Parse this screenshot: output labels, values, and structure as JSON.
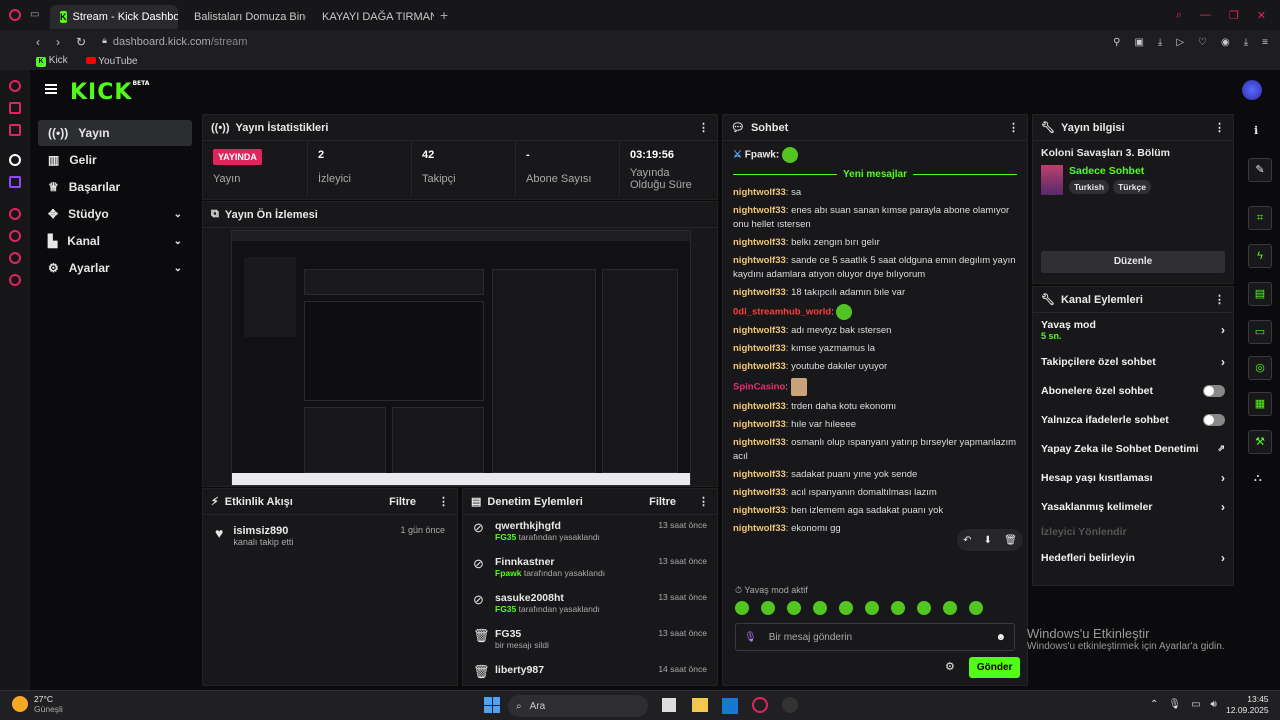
{
  "browser": {
    "tabs": [
      {
        "label": "Stream - Kick Dashboard"
      },
      {
        "label": "Balistaları Domuza Bindir"
      },
      {
        "label": "KAYAYI DAĞA TIRMANDIR"
      }
    ],
    "url_host": "dashboard.kick.com",
    "url_path": "/stream",
    "bookmarks": [
      "Kick",
      "YouTube"
    ]
  },
  "nav": {
    "items": [
      {
        "label": "Yayın"
      },
      {
        "label": "Gelir"
      },
      {
        "label": "Başarılar"
      },
      {
        "label": "Stüdyo"
      },
      {
        "label": "Kanal"
      },
      {
        "label": "Ayarlar"
      }
    ]
  },
  "stats": {
    "title": "Yayın İstatistikleri",
    "live_badge": "YAYINDA",
    "live_label": "Yayın",
    "viewers_value": "2",
    "viewers_label": "İzleyici",
    "followers_value": "42",
    "followers_label": "Takipçi",
    "subs_value": "-",
    "subs_label": "Abone Sayısı",
    "duration_value": "03:19:56",
    "duration_label": "Yayında Olduğu Süre"
  },
  "preview": {
    "title": "Yayın Ön İzlemesi"
  },
  "activity": {
    "title": "Etkinlik Akışı",
    "filter": "Filtre",
    "items": [
      {
        "user": "isimsiz890",
        "action": "kanalı takip etti",
        "time": "1 gün önce"
      }
    ]
  },
  "moderation": {
    "title": "Denetim Eylemleri",
    "filter": "Filtre",
    "items": [
      {
        "user": "qwerthkjhgfd",
        "by": "FG35",
        "action": "tarafından yasaklandı",
        "time": "13 saat önce"
      },
      {
        "user": "Finnkastner",
        "by": "Fpawk",
        "action": "tarafından yasaklandı",
        "time": "13 saat önce"
      },
      {
        "user": "sasuke2008ht",
        "by": "FG35",
        "action": "tarafından yasaklandı",
        "time": "13 saat önce"
      },
      {
        "user": "FG35",
        "by": "",
        "action": "bir mesajı sildi",
        "time": "13 saat önce"
      },
      {
        "user": "liberty987",
        "by": "",
        "action": "",
        "time": "14 saat önce"
      }
    ]
  },
  "chat": {
    "title": "Sohbet",
    "top_user": "Fpawk",
    "new_messages": "Yeni mesajlar",
    "messages": [
      {
        "user": "nightwolf33",
        "text": "sa"
      },
      {
        "user": "nightwolf33",
        "text": "enes abı suan sanan kımse parayla abone olamıyor onu hellet ıstersen"
      },
      {
        "user": "nightwolf33",
        "text": "belkı zengın bırı gelır"
      },
      {
        "user": "nightwolf33",
        "text": "sande ce 5 saatlık 5 saat oldguna emın degılım yayın kaydını adamlara atıyon oluyor dıye bılıyorum"
      },
      {
        "user": "nightwolf33",
        "text": "18 takıpcılı adamın bıle var"
      },
      {
        "user": "0di_streamhub_world",
        "text": ""
      },
      {
        "user": "nightwolf33",
        "text": "adı mevtyz bak ıstersen"
      },
      {
        "user": "nightwolf33",
        "text": "kımse yazmamus la"
      },
      {
        "user": "nightwolf33",
        "text": "youtube dakıler uyuyor"
      },
      {
        "user": "SpinCasino",
        "text": ""
      },
      {
        "user": "nightwolf33",
        "text": "trden daha kotu ekonomı"
      },
      {
        "user": "nightwolf33",
        "text": "hıle var hıleeee"
      },
      {
        "user": "nightwolf33",
        "text": "osmanlı olup ıspanyanı yatırıp bırseyler yapmanlazım acıl"
      },
      {
        "user": "nightwolf33",
        "text": "sadakat puanı yıne yok sende"
      },
      {
        "user": "nightwolf33",
        "text": "acıl ıspanyanın domaltılması lazım"
      },
      {
        "user": "nightwolf33",
        "text": "ben izlemem aga sadakat puanı yok"
      },
      {
        "user": "nightwolf33",
        "text": "ekonomı gg"
      }
    ],
    "slow_mode_note": "Yavaş mod aktif",
    "input_placeholder": "Bir mesaj gönderin",
    "send_label": "Gönder"
  },
  "stream_info": {
    "title": "Yayın bilgisi",
    "stream_title": "Koloni Savaşları 3. Bölüm",
    "category": "Sadece Sohbet",
    "tags": [
      "Turkish",
      "Türkçe"
    ],
    "edit_label": "Düzenle"
  },
  "channel_actions": {
    "title": "Kanal Eylemleri",
    "items": [
      {
        "label": "Yavaş mod",
        "sub": "5 sn."
      },
      {
        "label": "Takipçilere özel sohbet"
      },
      {
        "label": "Abonelere özel sohbet"
      },
      {
        "label": "Yalnızca ifadelerle sohbet"
      },
      {
        "label": "Yapay Zeka ile Sohbet Denetimi"
      },
      {
        "label": "Hesap yaşı kısıtlaması"
      },
      {
        "label": "Yasaklanmış kelimeler"
      },
      {
        "label": "İzleyici Yönlendir"
      },
      {
        "label": "Hedefleri belirleyin"
      }
    ]
  },
  "watermark": {
    "line1": "Windows'u Etkinleştir",
    "line2": "Windows'u etkinleştirmek için Ayarlar'a gidin."
  },
  "taskbar": {
    "weather_temp": "27°C",
    "weather_desc": "Güneşli",
    "search_placeholder": "Ara",
    "time": "13:45",
    "date": "12.09.2025"
  },
  "colors": {
    "accent": "#53fc18",
    "live": "#e0245e"
  }
}
